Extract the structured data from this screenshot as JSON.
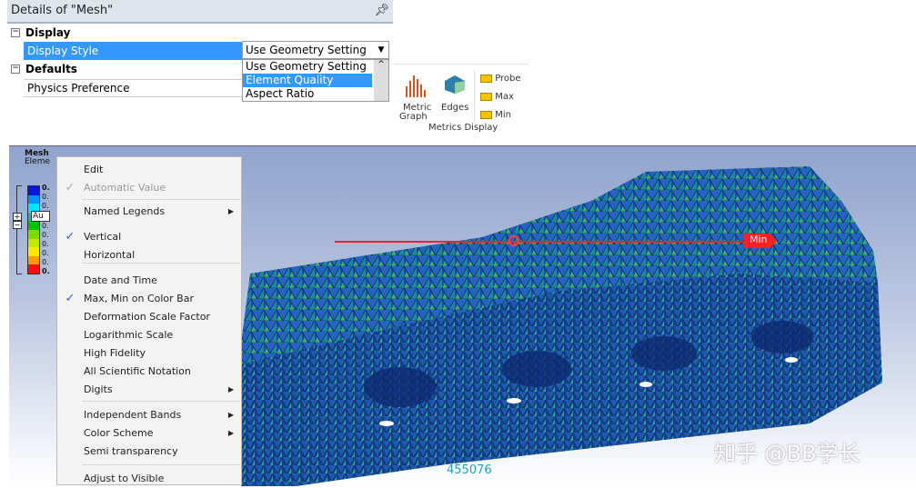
{
  "details": {
    "title": "Details of \"Mesh\"",
    "pin_icon": "pin-icon",
    "groups": [
      {
        "label": "Display"
      },
      {
        "label": "Defaults"
      }
    ],
    "rows": [
      {
        "label": "Display Style",
        "value": "Use Geometry Setting"
      },
      {
        "label": "Physics Preference",
        "value": ""
      }
    ],
    "dropdown_options": [
      "Use Geometry Setting",
      "Element Quality",
      "Aspect Ratio"
    ],
    "selected_option": "Element Quality",
    "highlight_color": "#3399ff"
  },
  "ribbon": {
    "group_label": "Metrics Display",
    "metric_graph": "Metric",
    "metric_graph2": "Graph",
    "edges": "Edges",
    "probe": "Probe",
    "max": "Max",
    "min": "Min"
  },
  "viewport": {
    "title": "Mesh",
    "subtitle": "Eleme",
    "legend_labels": [
      "0.",
      "0.",
      "0.",
      "Au",
      "0.",
      "0.",
      "0.",
      "0.",
      "0.",
      "0."
    ],
    "legend_colors": [
      "#0016d8",
      "#0090ff",
      "#00e4ff",
      "#00c8a0",
      "#00c000",
      "#80d800",
      "#c0e800",
      "#ffe800",
      "#ff9a00",
      "#ff1000"
    ],
    "min_label": "Min",
    "count": "455076",
    "watermark": "知乎 @BB学长"
  },
  "menu": {
    "items": [
      {
        "label": "Edit"
      },
      {
        "label": "Automatic Value",
        "disabled": true,
        "checked": true
      },
      {
        "label": "Named Legends",
        "submenu": true
      },
      {
        "label": "Vertical",
        "checked": true
      },
      {
        "label": "Horizontal"
      },
      {
        "label": "Date and Time"
      },
      {
        "label": "Max, Min on Color Bar",
        "checked": true
      },
      {
        "label": "Deformation Scale Factor"
      },
      {
        "label": "Logarithmic Scale"
      },
      {
        "label": "High Fidelity"
      },
      {
        "label": "All Scientific Notation"
      },
      {
        "label": "Digits",
        "submenu": true
      },
      {
        "label": "Independent Bands",
        "submenu": true
      },
      {
        "label": "Color Scheme",
        "submenu": true
      },
      {
        "label": "Semi transparency"
      },
      {
        "label": "Adjust to Visible"
      }
    ]
  }
}
